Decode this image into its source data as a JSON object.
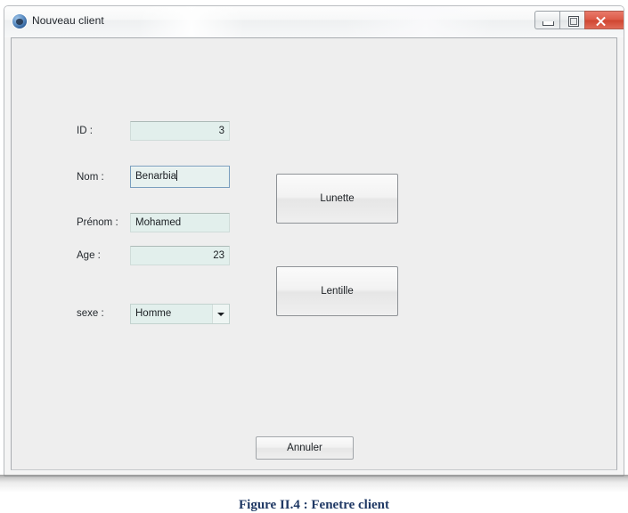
{
  "window": {
    "title": "Nouveau client",
    "icon": "app-icon",
    "controls": [
      {
        "name": "minimize",
        "glyph": "minimize-icon"
      },
      {
        "name": "maximize",
        "glyph": "maximize-icon"
      },
      {
        "name": "close",
        "glyph": "close-icon"
      }
    ]
  },
  "form": {
    "fields": [
      {
        "label": "ID :",
        "value": "3",
        "align": "right",
        "state": "readonly"
      },
      {
        "label": "Nom :",
        "value": "Benarbia",
        "align": "left",
        "state": "focused"
      },
      {
        "label": "Prénom :",
        "value": "Mohamed",
        "align": "left",
        "state": "normal"
      },
      {
        "label": "Age :",
        "value": "23",
        "align": "right",
        "state": "normal"
      },
      {
        "label": "sexe :",
        "value": "Homme",
        "align": "left",
        "state": "combobox"
      }
    ],
    "sexe_options": [
      "Homme"
    ]
  },
  "buttons": {
    "lunette": "Lunette",
    "lentille": "Lentille",
    "annuler": "Annuler"
  },
  "caption": {
    "text": "Figure II.4 : Fenetre client"
  },
  "colors": {
    "field_background": "#e2efec",
    "focus_border": "#7b9fbe",
    "client_background": "#eeeeee",
    "caption_color": "#1f3864",
    "close_button": "#cf4530"
  }
}
